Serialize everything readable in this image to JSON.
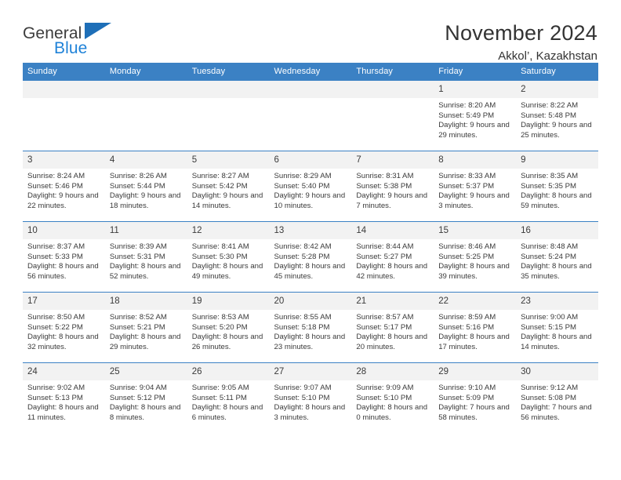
{
  "brand": {
    "name_top": "General",
    "name_bottom": "Blue",
    "triangle_color": "#1e6fb8",
    "blue_color": "#1f82d8"
  },
  "header": {
    "title": "November 2024",
    "subtitle": "Akkol’, Kazakhstan"
  },
  "theme": {
    "header_blue": "#3b81c4",
    "daynum_gray": "#f2f2f2",
    "text": "#333333"
  },
  "weekdays": [
    "Sunday",
    "Monday",
    "Tuesday",
    "Wednesday",
    "Thursday",
    "Friday",
    "Saturday"
  ],
  "labels": {
    "sunrise": "Sunrise:",
    "sunset": "Sunset:",
    "daylight": "Daylight:"
  },
  "weeks": [
    [
      {
        "day": "",
        "empty": true
      },
      {
        "day": "",
        "empty": true
      },
      {
        "day": "",
        "empty": true
      },
      {
        "day": "",
        "empty": true
      },
      {
        "day": "",
        "empty": true
      },
      {
        "day": "1",
        "sunrise": "Sunrise: 8:20 AM",
        "sunset": "Sunset: 5:49 PM",
        "daylight": "Daylight: 9 hours and 29 minutes."
      },
      {
        "day": "2",
        "sunrise": "Sunrise: 8:22 AM",
        "sunset": "Sunset: 5:48 PM",
        "daylight": "Daylight: 9 hours and 25 minutes."
      }
    ],
    [
      {
        "day": "3",
        "sunrise": "Sunrise: 8:24 AM",
        "sunset": "Sunset: 5:46 PM",
        "daylight": "Daylight: 9 hours and 22 minutes."
      },
      {
        "day": "4",
        "sunrise": "Sunrise: 8:26 AM",
        "sunset": "Sunset: 5:44 PM",
        "daylight": "Daylight: 9 hours and 18 minutes."
      },
      {
        "day": "5",
        "sunrise": "Sunrise: 8:27 AM",
        "sunset": "Sunset: 5:42 PM",
        "daylight": "Daylight: 9 hours and 14 minutes."
      },
      {
        "day": "6",
        "sunrise": "Sunrise: 8:29 AM",
        "sunset": "Sunset: 5:40 PM",
        "daylight": "Daylight: 9 hours and 10 minutes."
      },
      {
        "day": "7",
        "sunrise": "Sunrise: 8:31 AM",
        "sunset": "Sunset: 5:38 PM",
        "daylight": "Daylight: 9 hours and 7 minutes."
      },
      {
        "day": "8",
        "sunrise": "Sunrise: 8:33 AM",
        "sunset": "Sunset: 5:37 PM",
        "daylight": "Daylight: 9 hours and 3 minutes."
      },
      {
        "day": "9",
        "sunrise": "Sunrise: 8:35 AM",
        "sunset": "Sunset: 5:35 PM",
        "daylight": "Daylight: 8 hours and 59 minutes."
      }
    ],
    [
      {
        "day": "10",
        "sunrise": "Sunrise: 8:37 AM",
        "sunset": "Sunset: 5:33 PM",
        "daylight": "Daylight: 8 hours and 56 minutes."
      },
      {
        "day": "11",
        "sunrise": "Sunrise: 8:39 AM",
        "sunset": "Sunset: 5:31 PM",
        "daylight": "Daylight: 8 hours and 52 minutes."
      },
      {
        "day": "12",
        "sunrise": "Sunrise: 8:41 AM",
        "sunset": "Sunset: 5:30 PM",
        "daylight": "Daylight: 8 hours and 49 minutes."
      },
      {
        "day": "13",
        "sunrise": "Sunrise: 8:42 AM",
        "sunset": "Sunset: 5:28 PM",
        "daylight": "Daylight: 8 hours and 45 minutes."
      },
      {
        "day": "14",
        "sunrise": "Sunrise: 8:44 AM",
        "sunset": "Sunset: 5:27 PM",
        "daylight": "Daylight: 8 hours and 42 minutes."
      },
      {
        "day": "15",
        "sunrise": "Sunrise: 8:46 AM",
        "sunset": "Sunset: 5:25 PM",
        "daylight": "Daylight: 8 hours and 39 minutes."
      },
      {
        "day": "16",
        "sunrise": "Sunrise: 8:48 AM",
        "sunset": "Sunset: 5:24 PM",
        "daylight": "Daylight: 8 hours and 35 minutes."
      }
    ],
    [
      {
        "day": "17",
        "sunrise": "Sunrise: 8:50 AM",
        "sunset": "Sunset: 5:22 PM",
        "daylight": "Daylight: 8 hours and 32 minutes."
      },
      {
        "day": "18",
        "sunrise": "Sunrise: 8:52 AM",
        "sunset": "Sunset: 5:21 PM",
        "daylight": "Daylight: 8 hours and 29 minutes."
      },
      {
        "day": "19",
        "sunrise": "Sunrise: 8:53 AM",
        "sunset": "Sunset: 5:20 PM",
        "daylight": "Daylight: 8 hours and 26 minutes."
      },
      {
        "day": "20",
        "sunrise": "Sunrise: 8:55 AM",
        "sunset": "Sunset: 5:18 PM",
        "daylight": "Daylight: 8 hours and 23 minutes."
      },
      {
        "day": "21",
        "sunrise": "Sunrise: 8:57 AM",
        "sunset": "Sunset: 5:17 PM",
        "daylight": "Daylight: 8 hours and 20 minutes."
      },
      {
        "day": "22",
        "sunrise": "Sunrise: 8:59 AM",
        "sunset": "Sunset: 5:16 PM",
        "daylight": "Daylight: 8 hours and 17 minutes."
      },
      {
        "day": "23",
        "sunrise": "Sunrise: 9:00 AM",
        "sunset": "Sunset: 5:15 PM",
        "daylight": "Daylight: 8 hours and 14 minutes."
      }
    ],
    [
      {
        "day": "24",
        "sunrise": "Sunrise: 9:02 AM",
        "sunset": "Sunset: 5:13 PM",
        "daylight": "Daylight: 8 hours and 11 minutes."
      },
      {
        "day": "25",
        "sunrise": "Sunrise: 9:04 AM",
        "sunset": "Sunset: 5:12 PM",
        "daylight": "Daylight: 8 hours and 8 minutes."
      },
      {
        "day": "26",
        "sunrise": "Sunrise: 9:05 AM",
        "sunset": "Sunset: 5:11 PM",
        "daylight": "Daylight: 8 hours and 6 minutes."
      },
      {
        "day": "27",
        "sunrise": "Sunrise: 9:07 AM",
        "sunset": "Sunset: 5:10 PM",
        "daylight": "Daylight: 8 hours and 3 minutes."
      },
      {
        "day": "28",
        "sunrise": "Sunrise: 9:09 AM",
        "sunset": "Sunset: 5:10 PM",
        "daylight": "Daylight: 8 hours and 0 minutes."
      },
      {
        "day": "29",
        "sunrise": "Sunrise: 9:10 AM",
        "sunset": "Sunset: 5:09 PM",
        "daylight": "Daylight: 7 hours and 58 minutes."
      },
      {
        "day": "30",
        "sunrise": "Sunrise: 9:12 AM",
        "sunset": "Sunset: 5:08 PM",
        "daylight": "Daylight: 7 hours and 56 minutes."
      }
    ]
  ]
}
